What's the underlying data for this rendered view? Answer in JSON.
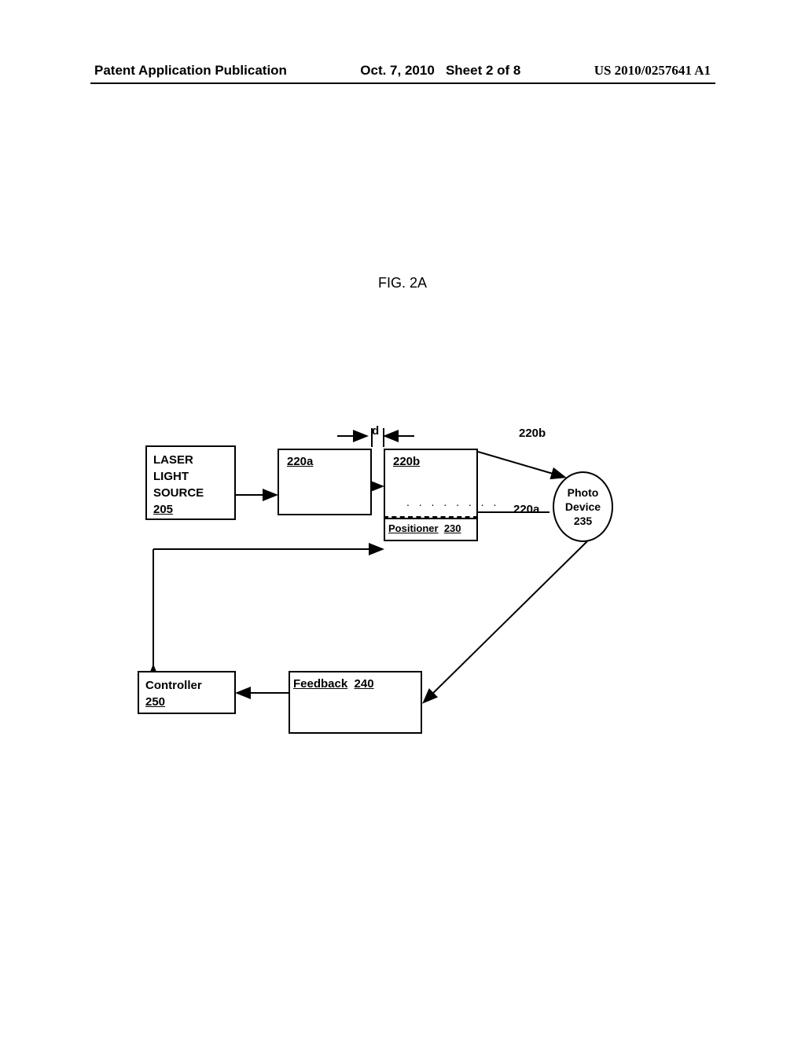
{
  "header": {
    "left": "Patent Application Publication",
    "center_date": "Oct. 7, 2010",
    "center_sheet": "Sheet 2 of 8",
    "right": "US 2010/0257641 A1"
  },
  "figure": {
    "title": "FIG. 2A",
    "d_label": "d",
    "label_220b_top": "220b",
    "label_220a_side": "220a"
  },
  "boxes": {
    "laser": {
      "line1": "LASER",
      "line2": "LIGHT",
      "line3": "SOURCE",
      "ref": "205"
    },
    "ref_220a": "220a",
    "ref_220b": "220b",
    "positioner": {
      "label": "Positioner",
      "ref": "230"
    },
    "photo": {
      "line1": "Photo",
      "line2": "Device",
      "ref": "235"
    },
    "feedback": {
      "label": "Feedback",
      "ref": "240"
    },
    "controller": {
      "label": "Controller",
      "ref": "250"
    }
  }
}
